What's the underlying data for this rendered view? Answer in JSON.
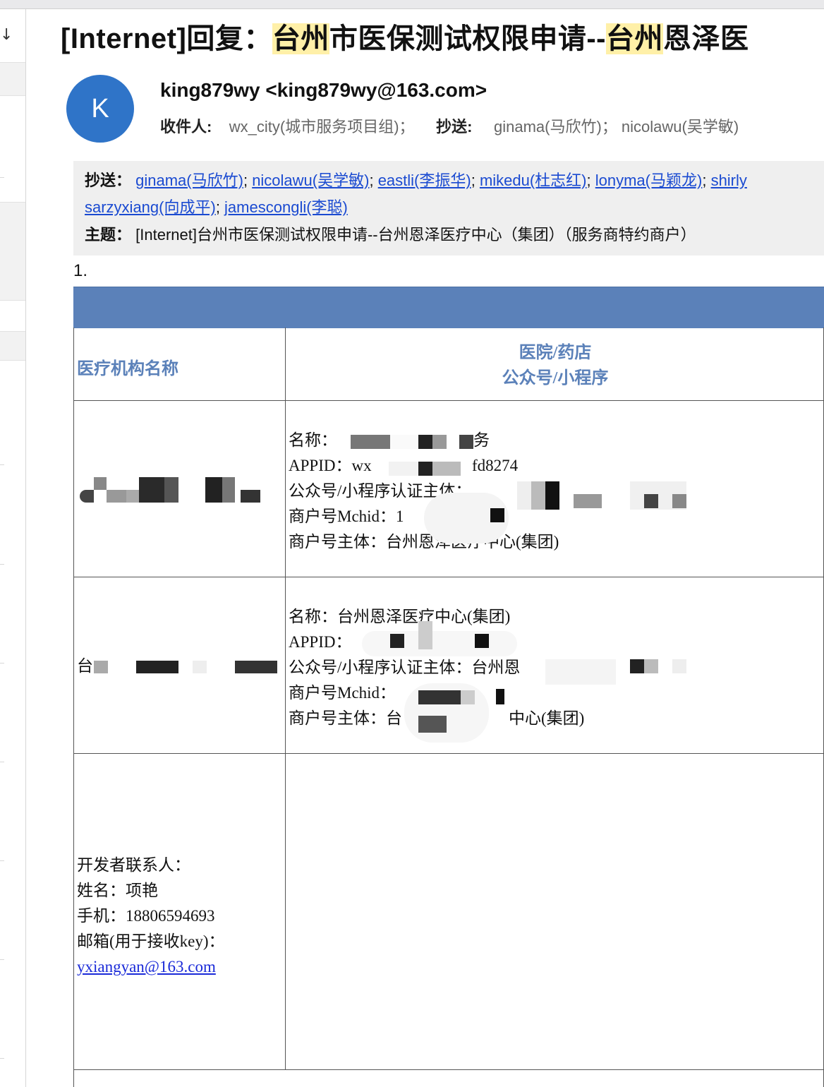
{
  "list_pane": {
    "sort_icon": "arrow-down-icon"
  },
  "email": {
    "subject_prefix": "[Internet]回复：",
    "subject_hl1": "台州",
    "subject_mid": "市医保测试权限申请--",
    "subject_hl2": "台州",
    "subject_tail": "恩泽医",
    "avatar_letter": "K",
    "sender": "king879wy <king879wy@163.com>",
    "to_label": "收件人:",
    "to_value": "wx_city(城市服务项目组)；",
    "cc_label": "抄送:",
    "cc_value": "ginama(马欣竹)；   nicolawu(吴学敏)"
  },
  "quoted": {
    "cc_label": "抄送：",
    "cc_list": [
      "ginama(马欣竹)",
      "nicolawu(吴学敏)",
      "eastli(李振华)",
      "mikedu(杜志红)",
      "lonyma(马颖龙)",
      "shirly"
    ],
    "cc_list_line2": [
      "sarzyxiang(向成平)",
      "jamescongli(李聪)"
    ],
    "subject_label": "主题：",
    "subject_value": "[Internet]台州市医保测试权限申请--台州恩泽医疗中心（集团）（服务商特约商户）"
  },
  "body": {
    "item_number": "1.",
    "table": {
      "header_left": "医疗机构名称",
      "header_right_line1": "医院/药店",
      "header_right_line2": "公众号/小程序",
      "row1_right": [
        "名称：",
        "APPID：wx",
        "公众号/小程序认证主体：",
        "商户号Mchid：1",
        "商户号主体：台州恩泽医疗中心(集团)"
      ],
      "row1_frag1": "务",
      "row1_frag2": "fd8274",
      "row2_left": "台",
      "row2_right": [
        "名称：台州恩泽医疗中心(集团)",
        "APPID：",
        "公众号/小程序认证主体：台州恩",
        "商户号Mchid：",
        "商户号主体：台",
        "中心(集团)"
      ],
      "row3_left": [
        "开发者联系人：",
        "姓名：项艳",
        "手机：18806594693",
        "邮箱(用于接收key)："
      ],
      "row3_email": "yxiangyan@163.com"
    }
  },
  "colors": {
    "avatar": "#2f74c8",
    "table_band": "#5b81b9",
    "highlight": "#fff0a8",
    "link": "#1a4ad1"
  }
}
